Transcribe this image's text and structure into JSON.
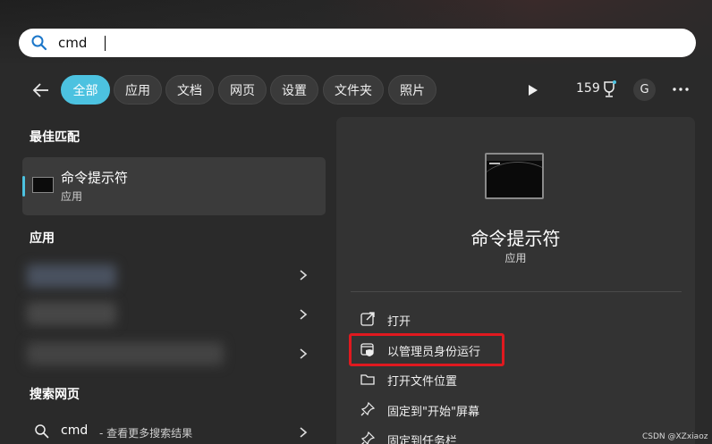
{
  "search": {
    "query": "cmd"
  },
  "filters": {
    "tabs": [
      "全部",
      "应用",
      "文档",
      "网页",
      "设置",
      "文件夹",
      "照片"
    ],
    "points": "159",
    "avatar_letter": "G"
  },
  "left": {
    "best_match_title": "最佳匹配",
    "best_match": {
      "name": "命令提示符",
      "type": "应用"
    },
    "apps_title": "应用",
    "web_title": "搜索网页",
    "web_query": "cmd",
    "web_hint": "- 查看更多搜索结果"
  },
  "detail": {
    "name": "命令提示符",
    "type": "应用",
    "actions": [
      {
        "label": "打开",
        "icon": "open-external-icon"
      },
      {
        "label": "以管理员身份运行",
        "icon": "run-as-admin-icon"
      },
      {
        "label": "打开文件位置",
        "icon": "folder-icon"
      },
      {
        "label": "固定到\"开始\"屏幕",
        "icon": "pin-icon"
      },
      {
        "label": "固定到任务栏",
        "icon": "pin-icon"
      }
    ]
  },
  "colors": {
    "accent": "#4cc2e0",
    "highlight": "#e0191f"
  },
  "watermark": "CSDN @XZxiaoz"
}
